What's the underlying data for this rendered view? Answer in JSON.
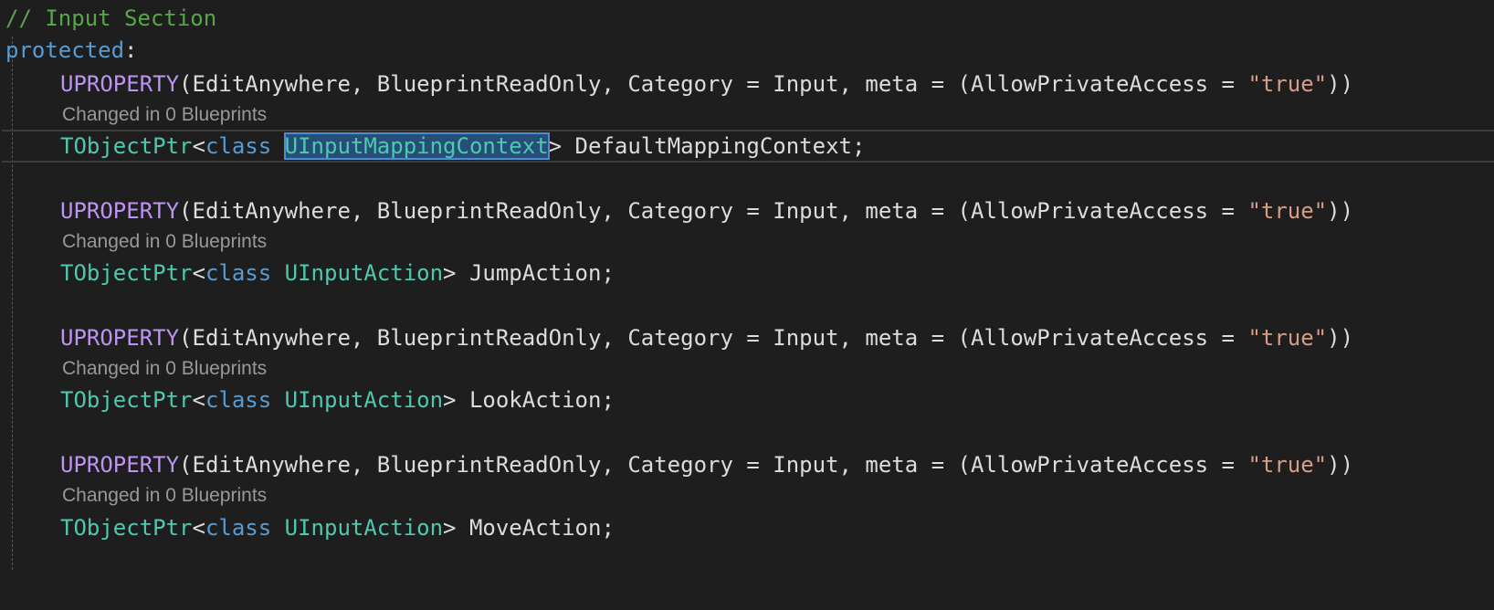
{
  "editor": {
    "comment": "// Input Section",
    "access_specifier": "protected",
    "colon": ":",
    "codelens_text": "Changed in 0 Blueprints",
    "uproperty": {
      "macro": "UPROPERTY",
      "open": "(",
      "args": "EditAnywhere, BlueprintReadOnly, Category = Input, meta = (AllowPrivateAccess = ",
      "string": "\"true\"",
      "close": "))"
    },
    "declarations": [
      {
        "ptr": "TObjectPtr",
        "lt": "<",
        "keyword": "class",
        "type": "UInputMappingContext",
        "gt": ">",
        "name": " DefaultMappingContext;"
      },
      {
        "ptr": "TObjectPtr",
        "lt": "<",
        "keyword": "class",
        "type": "UInputAction",
        "gt": ">",
        "name": " JumpAction;"
      },
      {
        "ptr": "TObjectPtr",
        "lt": "<",
        "keyword": "class",
        "type": "UInputAction",
        "gt": ">",
        "name": " LookAction;"
      },
      {
        "ptr": "TObjectPtr",
        "lt": "<",
        "keyword": "class",
        "type": "UInputAction",
        "gt": ">",
        "name": " MoveAction;"
      }
    ]
  },
  "colors": {
    "background": "#1e1e1e",
    "comment": "#57a64a",
    "keyword": "#569cd6",
    "macro": "#bd94f0",
    "type": "#4ec9b0",
    "string": "#d69d85",
    "selection": "#264f78"
  }
}
